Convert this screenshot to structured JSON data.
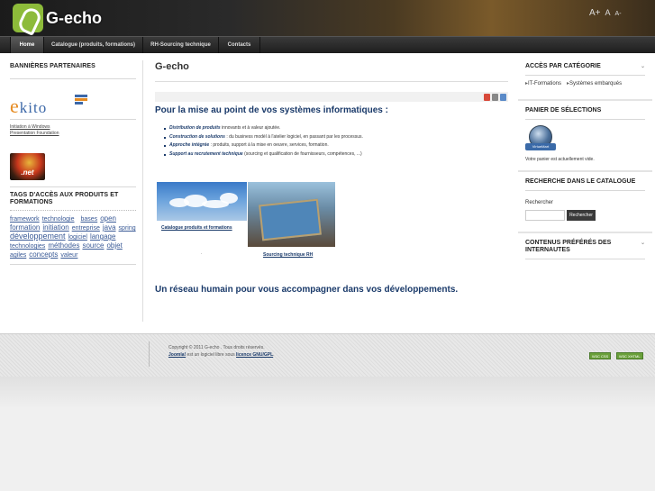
{
  "header": {
    "logo_text": "G-echo",
    "font_tools": [
      "A+",
      "A",
      "A-"
    ]
  },
  "nav": {
    "items": [
      {
        "label": "Home",
        "active": true
      },
      {
        "label": "Catalogue (produits, formations)",
        "active": false
      },
      {
        "label": "RH-Sourcing technique",
        "active": false
      },
      {
        "label": "Contacts",
        "active": false
      }
    ]
  },
  "left": {
    "partners_title": "BANNIÈRES PARTENAIRES",
    "ekito_text": "kito",
    "ekito_letter": "e",
    "partner_link_1": "Initiation à Windows",
    "partner_link_2": "Presentation Foundation",
    "net_logo_text": ".net",
    "tags_title": "TAGS D'ACCÈS AUX PRODUITS ET FORMATIONS",
    "tags": [
      "framework",
      "technologie",
      "bases",
      "open",
      "formation",
      "initiation",
      "entreprise",
      "java",
      "spring",
      "développement",
      "logiciel",
      "langage",
      "technologies",
      "méthodes",
      "source",
      "objet",
      "agiles",
      "concepts",
      "valeur"
    ]
  },
  "main": {
    "title": "G-echo",
    "heading": "Pour la mise au point de vos systèmes informatiques :",
    "bullets": [
      {
        "bold": "Distribution de produits",
        "text": " innovants et à valeur ajoutée."
      },
      {
        "bold": "Construction de solutions",
        "text": " : du business modèl à l'atelier logiciel, en passant par les processus."
      },
      {
        "bold": "Approche intégrée",
        "text": " : produits, support à la mise en oeuvre, services, formation."
      },
      {
        "bold": "Support au recrutement technique",
        "text": " (sourcing et qualification de fournisseurs, compétences, ...)"
      }
    ],
    "caption_1": "Catalogue produits et formations",
    "caption_2": "Sourcing technique RH",
    "dot": ".",
    "heading_2": "Un réseau humain pour vous accompagner dans vos développements."
  },
  "right": {
    "category_title": "ACCÈS PAR CATÉGORIE",
    "categories": [
      "IT-Formations",
      "Systèmes embarqués"
    ],
    "cart_title": "PANIER DE SÉLECTIONS",
    "cart_icon_label": "VirtueMart",
    "cart_empty": "Votre panier est actuellement vide.",
    "search_title": "RECHERCHE DANS LE CATALOGUE",
    "search_label": "Rechercher",
    "search_value": "",
    "search_button": "Rechercher",
    "popular_title": "CONTENUS PRÉFÉRÉS DES INTERNAUTES"
  },
  "footer": {
    "copyright": "Copyright © 2011 G-echo . Tous droits réservés.",
    "joomla_link": "Joomla!",
    "joomla_text": " est un logiciel libre sous ",
    "license_link": "licence GNU/GPL",
    "license_end": ".",
    "badge_1": "W3C CSS",
    "badge_2": "W3C XHTML"
  },
  "colors": {
    "accent": "#1a3a6a",
    "tag_link": "#3a5a96",
    "nav_bg": "#2a2a2a"
  }
}
